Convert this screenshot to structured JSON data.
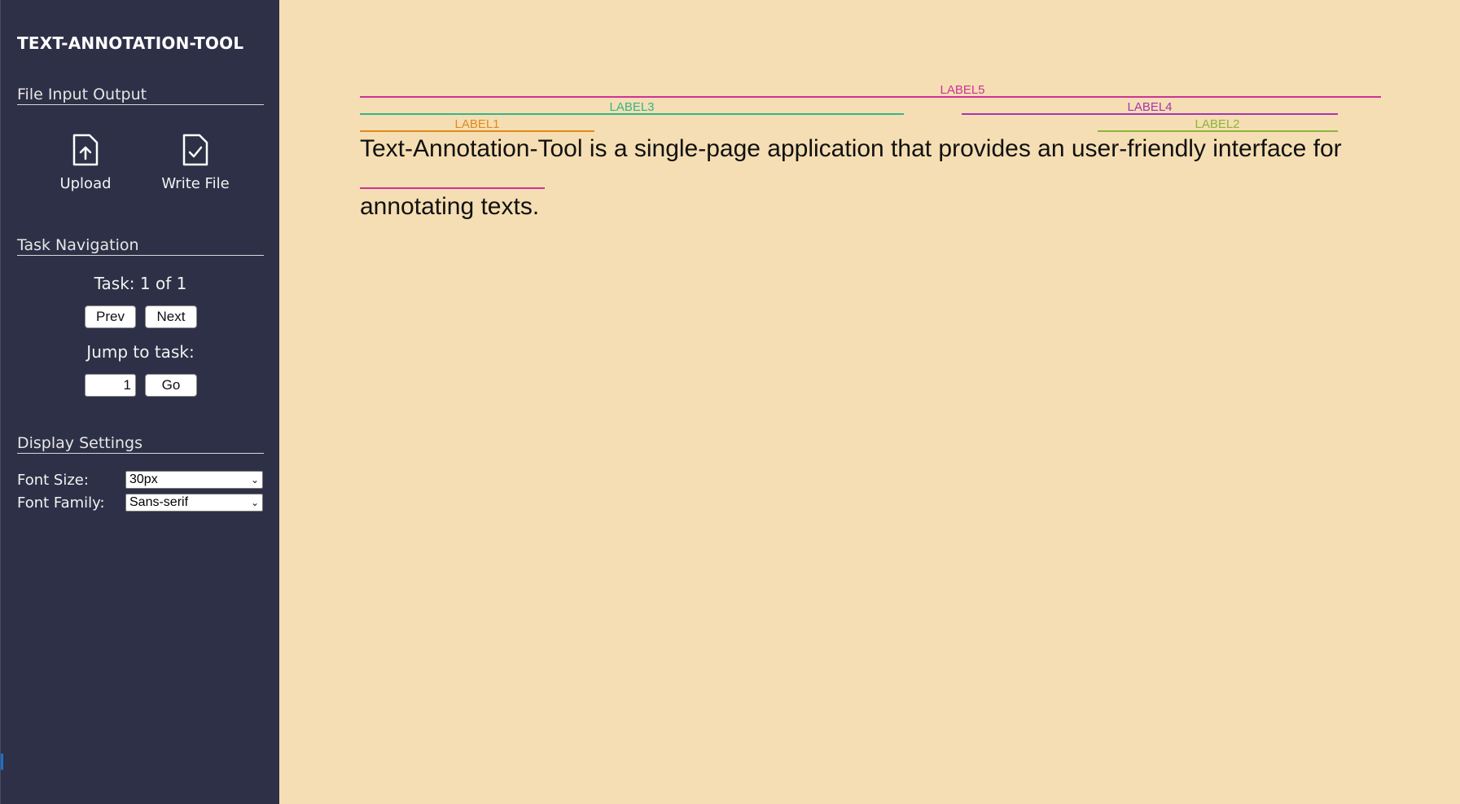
{
  "app": {
    "title": "TEXT-ANNOTATION-TOOL"
  },
  "sidebar": {
    "file_section": {
      "title": "File Input Output",
      "upload_label": "Upload",
      "upload_icon": "upload-file-icon",
      "write_label": "Write File",
      "write_icon": "file-check-icon"
    },
    "task_section": {
      "title": "Task Navigation",
      "task_status": "Task: 1 of 1",
      "prev_label": "Prev",
      "next_label": "Next",
      "jump_label": "Jump to task:",
      "jump_value": "1",
      "go_label": "Go"
    },
    "display_section": {
      "title": "Display Settings",
      "font_size_label": "Font Size:",
      "font_size_value": "30px",
      "font_family_label": "Font Family:",
      "font_family_value": "Sans-serif"
    }
  },
  "document": {
    "lines": [
      "Text-Annotation-Tool is a single-page application that provides an user-friendly interface for",
      "annotating texts."
    ]
  },
  "annotations": [
    {
      "label": "LABEL5",
      "color": "#cc3399"
    },
    {
      "label": "LABEL3",
      "color": "#33b58a"
    },
    {
      "label": "LABEL4",
      "color": "#a833b5"
    },
    {
      "label": "LABEL1",
      "color": "#e08a1a"
    },
    {
      "label": "LABEL2",
      "color": "#8ab53a"
    }
  ],
  "colors": {
    "sidebar_bg": "#2e3047",
    "main_bg": "#f5deb3"
  }
}
